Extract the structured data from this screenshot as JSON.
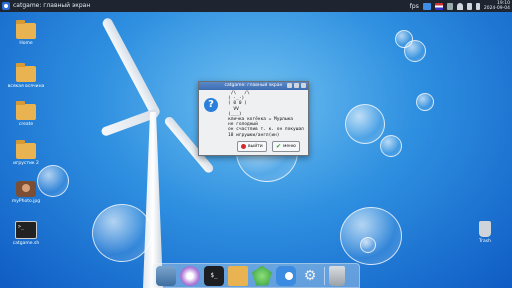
{
  "topbar": {
    "window_title": "catgame: главный экран",
    "tray_label": "fps",
    "clock_time": "19:10",
    "clock_date": "2024-09-04"
  },
  "desktop_icons": [
    {
      "label": "Home"
    },
    {
      "label": "всякая всячина"
    },
    {
      "label": "create"
    },
    {
      "label": "игрустик 2"
    },
    {
      "label": "myPhoto.jpg"
    },
    {
      "label": "catgame.sh"
    },
    {
      "label": "Trash"
    }
  ],
  "dialog": {
    "title": "catgame: главный экран",
    "message": " /\\   /\\\n( ·_·)\n( 0 0 )\n  VV\n(___) \nкличка котёнка = Мурлыка\nне голодный\nон счастлив т. к. он покушал\n18 игрушки/англ(ин)",
    "exit_label": "выйти",
    "menu_label": "меню"
  },
  "colors": {
    "sky": "#2e8fe0",
    "panel": "#1e2430",
    "dialog_title": "#3c6cb0",
    "question_icon": "#2b7fdc"
  },
  "dock": {
    "items": [
      "finder-icon",
      "browser-icon",
      "terminal-icon",
      "folder-icon",
      "gem-icon",
      "toggle-icon",
      "settings-icon",
      "trash-icon"
    ]
  }
}
